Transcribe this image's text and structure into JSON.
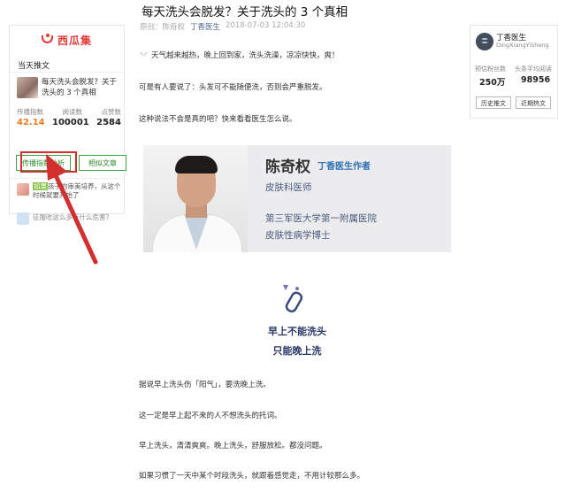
{
  "article": {
    "title": "每天洗头会脱发？关于洗头的 3 个真相",
    "meta": {
      "prefix": "原创：",
      "author": "陈奇权",
      "source": "丁香医生",
      "datetime": "2018-07-03 12:04:30"
    },
    "paragraphs": [
      "天气越来越热，晚上回到家，洗头洗澡，凉凉快快，爽！",
      "可是有人要说了：头发可不能随便洗，否则会严重脱发。",
      "这种说法不会是真的吧？快来看看医生怎么说。"
    ],
    "author_card": {
      "name": "陈奇权",
      "role": "丁香医生作者",
      "title": "皮肤科医师",
      "hospital": "第三军医大学第一附属医院",
      "degree": "皮肤性病学博士"
    },
    "section": {
      "heading1": "早上不能洗头",
      "heading2": "只能晚上洗"
    },
    "paragraphs2": [
      "据说早上洗头伤「阳气」，要洗晚上洗。",
      "这一定是早上起不来的人不想洗头的托词。",
      "早上洗头，清清爽爽。晚上洗头，舒服放松。都没问题。",
      "如果习惯了一天中某个时段洗头，就跟着感觉走，不用计较那么多。"
    ]
  },
  "left_panel": {
    "logo": "西瓜集",
    "section_title": "当天推文",
    "item_title": "每天洗头会脱发？关于洗头的 3 个真相",
    "stats": [
      {
        "label": "传播指数",
        "value": "42.14"
      },
      {
        "label": "阅读数",
        "value": "100001"
      },
      {
        "label": "点赞数",
        "value": "2584"
      }
    ],
    "btn_spread": "传播指数分析",
    "btn_similar": "相似文章",
    "related": [
      {
        "highlight": "如果",
        "text": "孩子的审美培养，从这个时候就要开始了"
      },
      {
        "highlight": "",
        "text": "征服吃这么多有什么危害？"
      }
    ]
  },
  "right_panel": {
    "name": "丁香医生",
    "pinyin": "DingXiangYiSheng",
    "stat1_label": "预估粉丝数",
    "stat1_value": "250万",
    "stat2_label": "头条平均阅读",
    "stat2_value": "98956",
    "btn_history": "历史推文",
    "btn_recent": "近期热文"
  },
  "colors": {
    "accent_green": "#3aa340",
    "highlight_red": "#d32f2f",
    "spread_value_orange": "#e67e22",
    "source_blue": "#576b95",
    "heading_navy": "#2b3a67"
  }
}
